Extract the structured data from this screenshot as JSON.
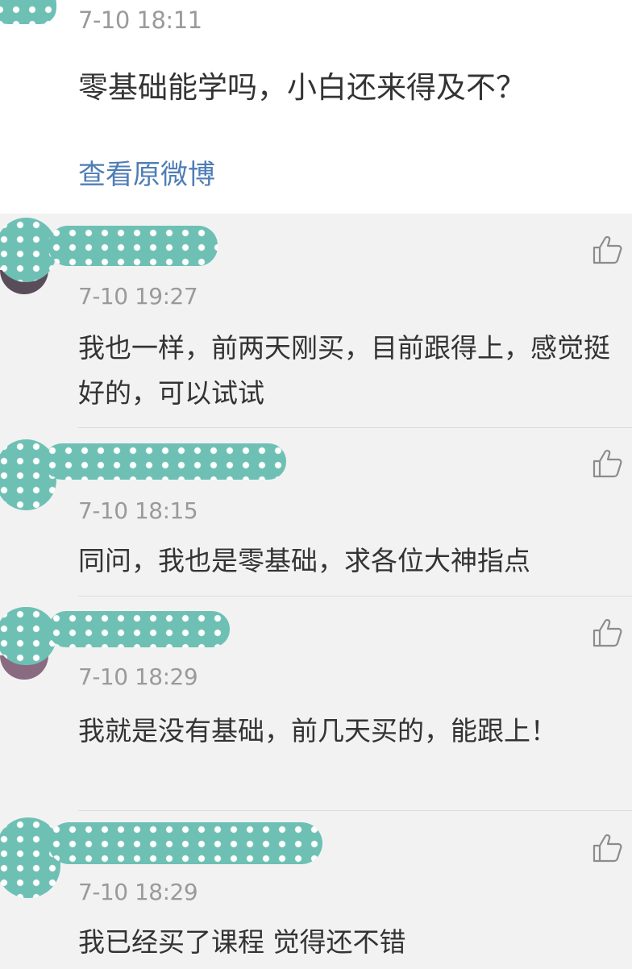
{
  "post": {
    "timestamp": "7-10 18:11",
    "text": "零基础能学吗，小白还来得及不？",
    "view_original": "查看原微博"
  },
  "comments": [
    {
      "timestamp": "7-10 19:27",
      "text": "我也一样，前两天刚买，目前跟得上，感觉挺好的，可以试试"
    },
    {
      "timestamp": "7-10 18:15",
      "text": "同问，我也是零基础，求各位大神指点"
    },
    {
      "timestamp": "7-10 18:29",
      "text": "我就是没有基础，前几天买的，能跟上！"
    },
    {
      "timestamp": "7-10 18:29",
      "text": "我已经买了课程 觉得还不错"
    }
  ],
  "icons": {
    "like": "thumbs-up-icon"
  },
  "colors": {
    "link": "#4f7db5",
    "timestamp": "#9a9a9a",
    "text": "#333333",
    "redaction_mask": "#6ec0b5",
    "comment_background": "#f2f2f2",
    "post_background": "#ffffff"
  }
}
